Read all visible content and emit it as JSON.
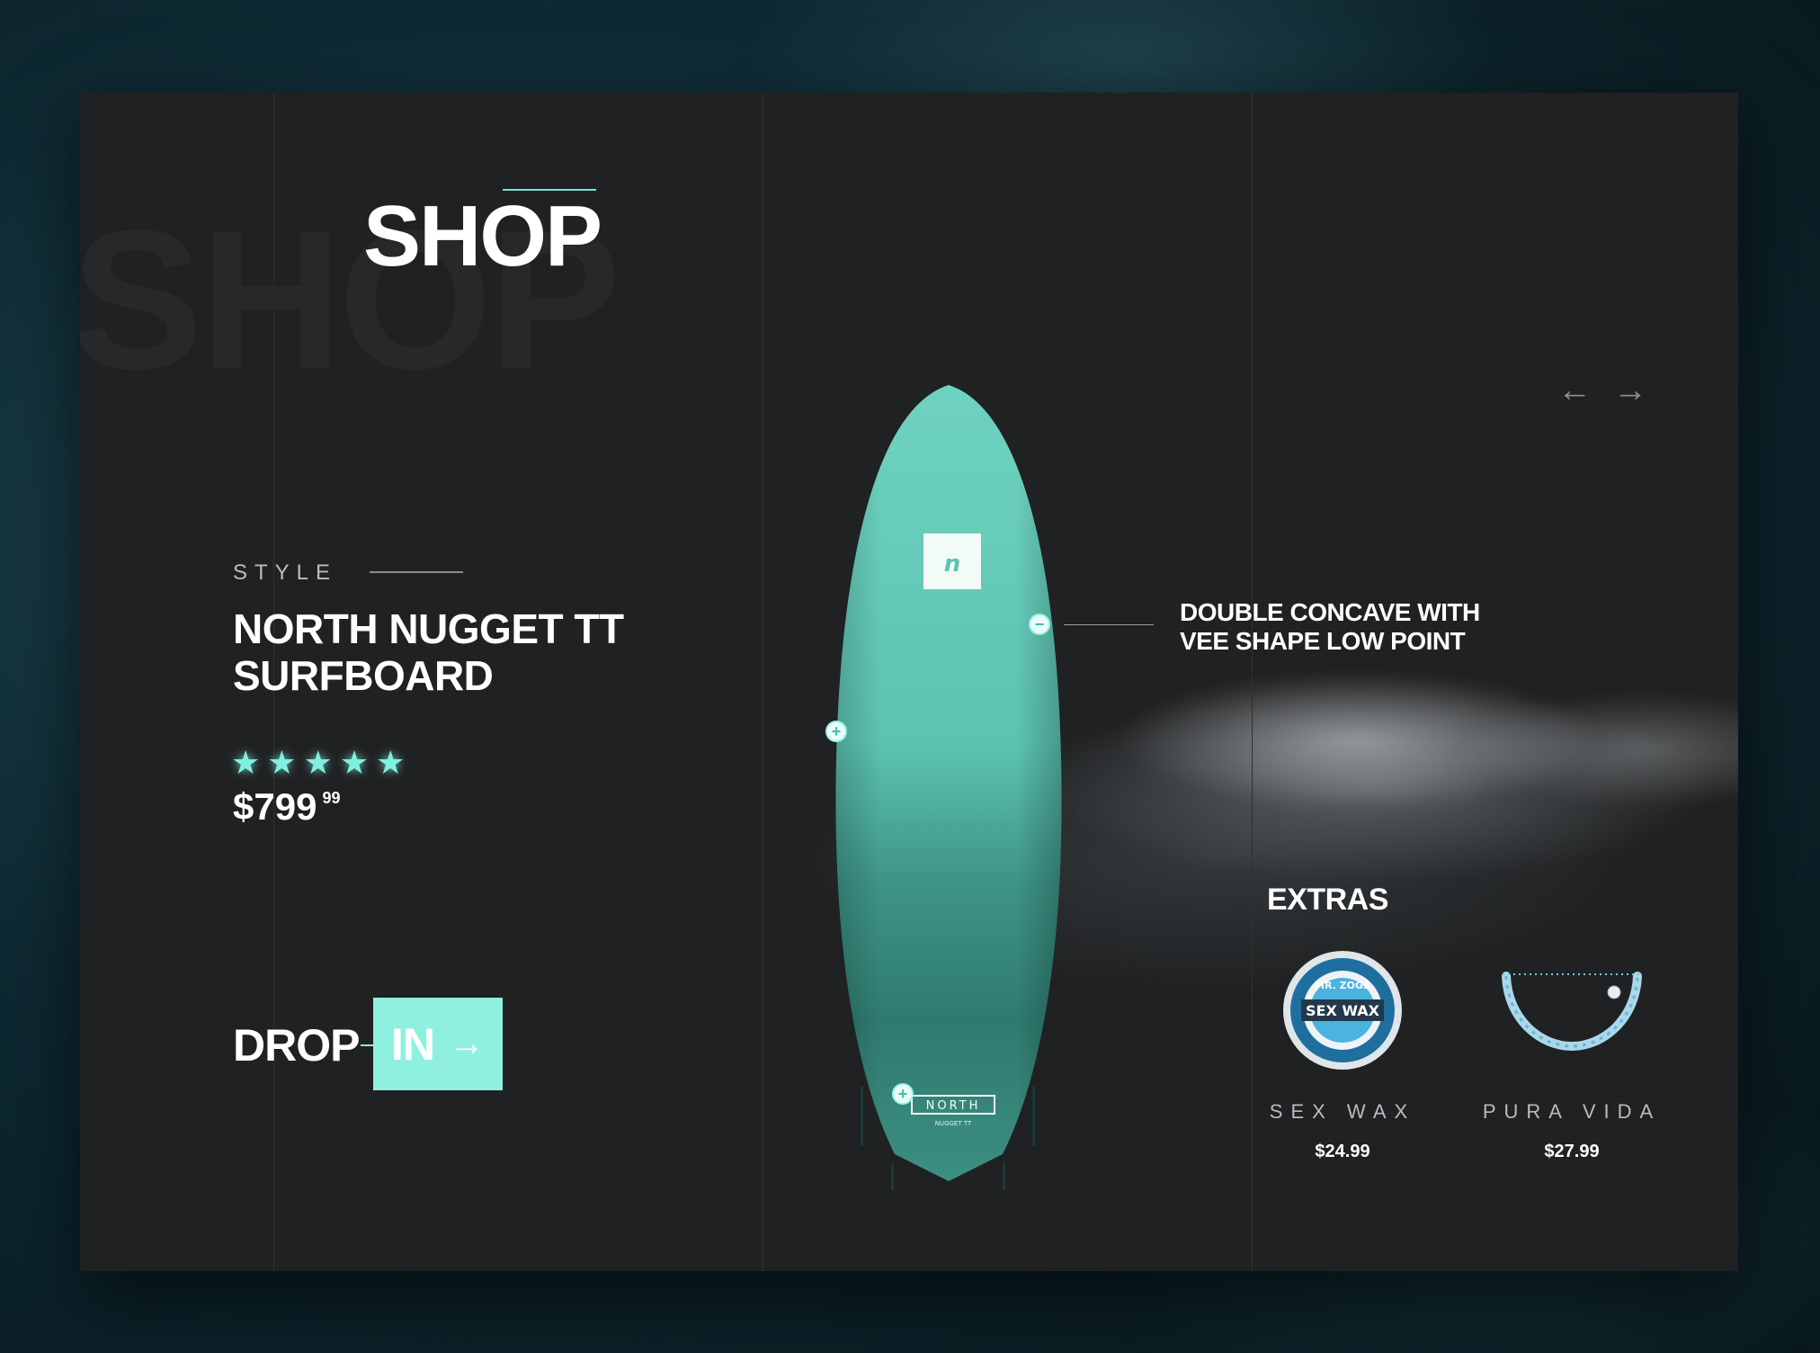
{
  "colors": {
    "accent": "#8ff0df",
    "panel": "#202122",
    "text": "#ffffff",
    "muted": "#b9bcbf"
  },
  "header": {
    "title": "SHOP",
    "ghost_title": "SHOP"
  },
  "product": {
    "style_label": "STYLE",
    "name_line1": "NORTH NUGGET TT",
    "name_line2": "SURFBOARD",
    "rating": 5,
    "rating_max": 5,
    "price_main": "$799",
    "price_cents": "99"
  },
  "cta": {
    "prefix": "DROP",
    "button_label": "IN",
    "icon": "arrow-right-icon"
  },
  "board": {
    "logo_brand": "NORTH",
    "logo_subtitle": "NUGGET TT"
  },
  "callout": {
    "line1": "DOUBLE CONCAVE WITH",
    "line2": "VEE SHAPE LOW POINT"
  },
  "nav": {
    "prev_icon": "arrow-left-icon",
    "next_icon": "arrow-right-icon"
  },
  "extras": {
    "title": "EXTRAS",
    "items": [
      {
        "name": "SEX WAX",
        "price": "$24.99",
        "icon": "wax-tin",
        "label_line1": "MR. ZOGS",
        "label_line2": "SEX WAX"
      },
      {
        "name": "PURA VIDA",
        "price": "$27.99",
        "icon": "bracelet"
      }
    ]
  }
}
